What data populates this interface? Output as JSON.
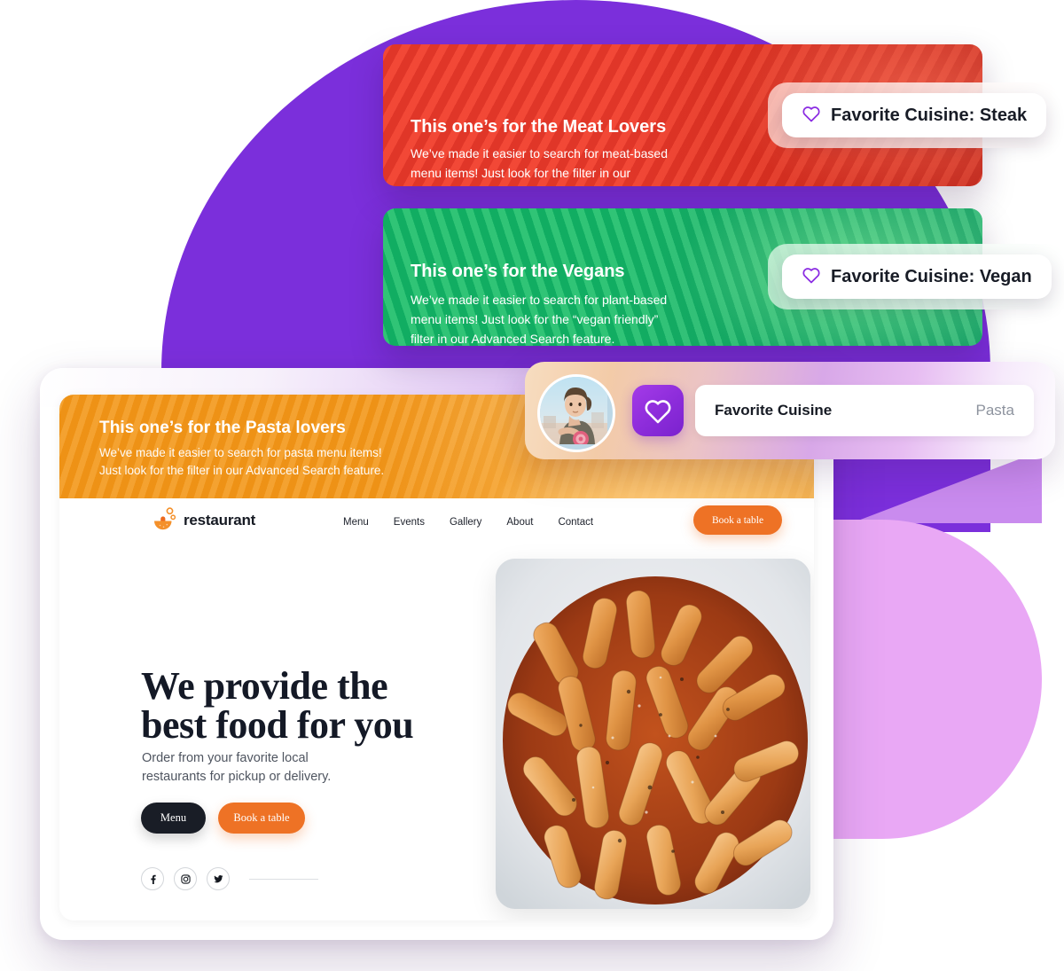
{
  "colors": {
    "purple_blob": "#7B2FDB",
    "lilac_blob": "#E9A8F5",
    "meat_card": "#EE3D2E",
    "vegan_card": "#13B868",
    "pasta_card": "#F09316",
    "accent_orange": "#EE7225",
    "heart_purple": "#8C2CDA",
    "dark": "#191D26"
  },
  "promos": [
    {
      "id": "meat",
      "title": "This one’s for the Meat Lovers",
      "body": "We’ve made it easier to search for meat-based\nmenu items! Just look for the filter in our\nAdvanced Search feature."
    },
    {
      "id": "vegan",
      "title": "This one’s for the Vegans",
      "body": "We’ve made it easier to search for plant-based\nmenu items! Just look for the “vegan friendly”\nfilter in our Advanced Search feature."
    },
    {
      "id": "pasta",
      "title": "This one’s for the Pasta lovers",
      "body": "We’ve made it easier to search for pasta menu items!\nJust look for the filter in our Advanced Search feature."
    }
  ],
  "pills": [
    {
      "id": "steak",
      "icon": "heart-outline-icon",
      "label": "Favorite Cuisine: Steak"
    },
    {
      "id": "vegan",
      "icon": "heart-outline-icon",
      "label": "Favorite Cuisine: Vegan"
    }
  ],
  "profile_card": {
    "avatar_alt": "user-avatar",
    "icon": "heart-filled-icon",
    "field_label": "Favorite Cuisine",
    "field_value": "Pasta"
  },
  "site": {
    "logo": {
      "icon": "bowl-icon",
      "text": "restaurant"
    },
    "nav_links": [
      "Menu",
      "Events",
      "Gallery",
      "About",
      "Contact"
    ],
    "nav_cta": "Book a table",
    "hero": {
      "title": "We provide the\nbest food for you",
      "subtitle": "Order from your favorite local\nrestaurants for pickup or delivery.",
      "primary_button": "Menu",
      "secondary_button": "Book a table"
    },
    "socials": [
      "facebook-icon",
      "instagram-icon",
      "twitter-icon"
    ],
    "hero_image_alt": "penne-pasta-bowl-photo"
  }
}
